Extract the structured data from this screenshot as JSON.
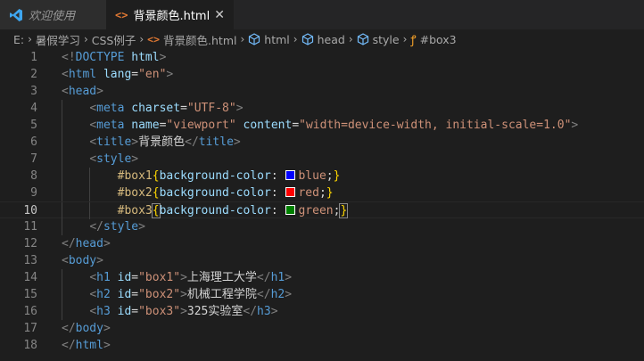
{
  "tabs": {
    "welcome_label": "欢迎使用",
    "active_label": "背景颜色.html",
    "close_glyph": "✕"
  },
  "breadcrumb": {
    "items": [
      "E:",
      "暑假学习",
      "CSS例子",
      "背景颜色.html",
      "html",
      "head",
      "style",
      "#box3"
    ]
  },
  "code": {
    "line_numbers": [
      "1",
      "2",
      "3",
      "4",
      "5",
      "6",
      "7",
      "8",
      "9",
      "10",
      "11",
      "12",
      "13",
      "14",
      "15",
      "16",
      "17",
      "18"
    ],
    "current_line": "10",
    "lines": [
      [
        [
          "t-punc",
          "<!"
        ],
        [
          "t-tag",
          "DOCTYPE"
        ],
        [
          "t-text",
          " "
        ],
        [
          "t-attr",
          "html"
        ],
        [
          "t-punc",
          ">"
        ]
      ],
      [
        [
          "t-punc",
          "<"
        ],
        [
          "t-tag",
          "html"
        ],
        [
          "t-text",
          " "
        ],
        [
          "t-attr",
          "lang"
        ],
        [
          "t-text",
          "="
        ],
        [
          "t-str",
          "\"en\""
        ],
        [
          "t-punc",
          ">"
        ]
      ],
      [
        [
          "t-punc",
          "<"
        ],
        [
          "t-tag",
          "head"
        ],
        [
          "t-punc",
          ">"
        ]
      ],
      [
        [
          "t-text",
          "    "
        ],
        [
          "t-punc",
          "<"
        ],
        [
          "t-tag",
          "meta"
        ],
        [
          "t-text",
          " "
        ],
        [
          "t-attr",
          "charset"
        ],
        [
          "t-text",
          "="
        ],
        [
          "t-str",
          "\"UTF-8\""
        ],
        [
          "t-punc",
          ">"
        ]
      ],
      [
        [
          "t-text",
          "    "
        ],
        [
          "t-punc",
          "<"
        ],
        [
          "t-tag",
          "meta"
        ],
        [
          "t-text",
          " "
        ],
        [
          "t-attr",
          "name"
        ],
        [
          "t-text",
          "="
        ],
        [
          "t-str",
          "\"viewport\""
        ],
        [
          "t-text",
          " "
        ],
        [
          "t-attr",
          "content"
        ],
        [
          "t-text",
          "="
        ],
        [
          "t-str",
          "\"width=device-width, initial-scale=1.0\""
        ],
        [
          "t-punc",
          ">"
        ]
      ],
      [
        [
          "t-text",
          "    "
        ],
        [
          "t-punc",
          "<"
        ],
        [
          "t-tag",
          "title"
        ],
        [
          "t-punc",
          ">"
        ],
        [
          "t-text",
          "背景颜色"
        ],
        [
          "t-punc",
          "</"
        ],
        [
          "t-tag",
          "title"
        ],
        [
          "t-punc",
          ">"
        ]
      ],
      [
        [
          "t-text",
          "    "
        ],
        [
          "t-punc",
          "<"
        ],
        [
          "t-tag",
          "style"
        ],
        [
          "t-punc",
          ">"
        ]
      ],
      [
        [
          "t-text",
          "        "
        ],
        [
          "t-sel",
          "#box1"
        ],
        [
          "t-brace",
          "{"
        ],
        [
          "t-prop",
          "background-color"
        ],
        [
          "t-text",
          ": "
        ],
        [
          "swatch",
          "#0000ff"
        ],
        [
          "t-val",
          "blue"
        ],
        [
          "t-text",
          ";"
        ],
        [
          "t-brace",
          "}"
        ]
      ],
      [
        [
          "t-text",
          "        "
        ],
        [
          "t-sel",
          "#box2"
        ],
        [
          "t-brace",
          "{"
        ],
        [
          "t-prop",
          "background-color"
        ],
        [
          "t-text",
          ": "
        ],
        [
          "swatch",
          "#ff0000"
        ],
        [
          "t-val",
          "red"
        ],
        [
          "t-text",
          ";"
        ],
        [
          "t-brace",
          "}"
        ]
      ],
      [
        [
          "t-text",
          "        "
        ],
        [
          "t-sel",
          "#box3"
        ],
        [
          "t-brace t-bracket-match",
          "{"
        ],
        [
          "t-prop",
          "background-color"
        ],
        [
          "t-text",
          ": "
        ],
        [
          "swatch",
          "#008000"
        ],
        [
          "t-val",
          "green"
        ],
        [
          "t-text",
          ";"
        ],
        [
          "t-brace t-bracket-match",
          "}"
        ]
      ],
      [
        [
          "t-text",
          "    "
        ],
        [
          "t-punc",
          "</"
        ],
        [
          "t-tag",
          "style"
        ],
        [
          "t-punc",
          ">"
        ]
      ],
      [
        [
          "t-punc",
          "</"
        ],
        [
          "t-tag",
          "head"
        ],
        [
          "t-punc",
          ">"
        ]
      ],
      [
        [
          "t-punc",
          "<"
        ],
        [
          "t-tag",
          "body"
        ],
        [
          "t-punc",
          ">"
        ]
      ],
      [
        [
          "t-text",
          "    "
        ],
        [
          "t-punc",
          "<"
        ],
        [
          "t-tag",
          "h1"
        ],
        [
          "t-text",
          " "
        ],
        [
          "t-attr",
          "id"
        ],
        [
          "t-text",
          "="
        ],
        [
          "t-str",
          "\"box1\""
        ],
        [
          "t-punc",
          ">"
        ],
        [
          "t-text",
          "上海理工大学"
        ],
        [
          "t-punc",
          "</"
        ],
        [
          "t-tag",
          "h1"
        ],
        [
          "t-punc",
          ">"
        ]
      ],
      [
        [
          "t-text",
          "    "
        ],
        [
          "t-punc",
          "<"
        ],
        [
          "t-tag",
          "h2"
        ],
        [
          "t-text",
          " "
        ],
        [
          "t-attr",
          "id"
        ],
        [
          "t-text",
          "="
        ],
        [
          "t-str",
          "\"box2\""
        ],
        [
          "t-punc",
          ">"
        ],
        [
          "t-text",
          "机械工程学院"
        ],
        [
          "t-punc",
          "</"
        ],
        [
          "t-tag",
          "h2"
        ],
        [
          "t-punc",
          ">"
        ]
      ],
      [
        [
          "t-text",
          "    "
        ],
        [
          "t-punc",
          "<"
        ],
        [
          "t-tag",
          "h3"
        ],
        [
          "t-text",
          " "
        ],
        [
          "t-attr",
          "id"
        ],
        [
          "t-text",
          "="
        ],
        [
          "t-str",
          "\"box3\""
        ],
        [
          "t-punc",
          ">"
        ],
        [
          "t-text",
          "325实验室"
        ],
        [
          "t-punc",
          "</"
        ],
        [
          "t-tag",
          "h3"
        ],
        [
          "t-punc",
          ">"
        ]
      ],
      [
        [
          "t-punc",
          "</"
        ],
        [
          "t-tag",
          "body"
        ],
        [
          "t-punc",
          ">"
        ]
      ],
      [
        [
          "t-punc",
          "</"
        ],
        [
          "t-tag",
          "html"
        ],
        [
          "t-punc",
          ">"
        ]
      ]
    ]
  },
  "colors": {
    "editor_bg": "#1e1e1e",
    "tabbar_bg": "#252526",
    "keyword": "#569cd6",
    "attribute": "#9cdcfe",
    "string": "#ce9178",
    "selector": "#d7ba7d"
  }
}
